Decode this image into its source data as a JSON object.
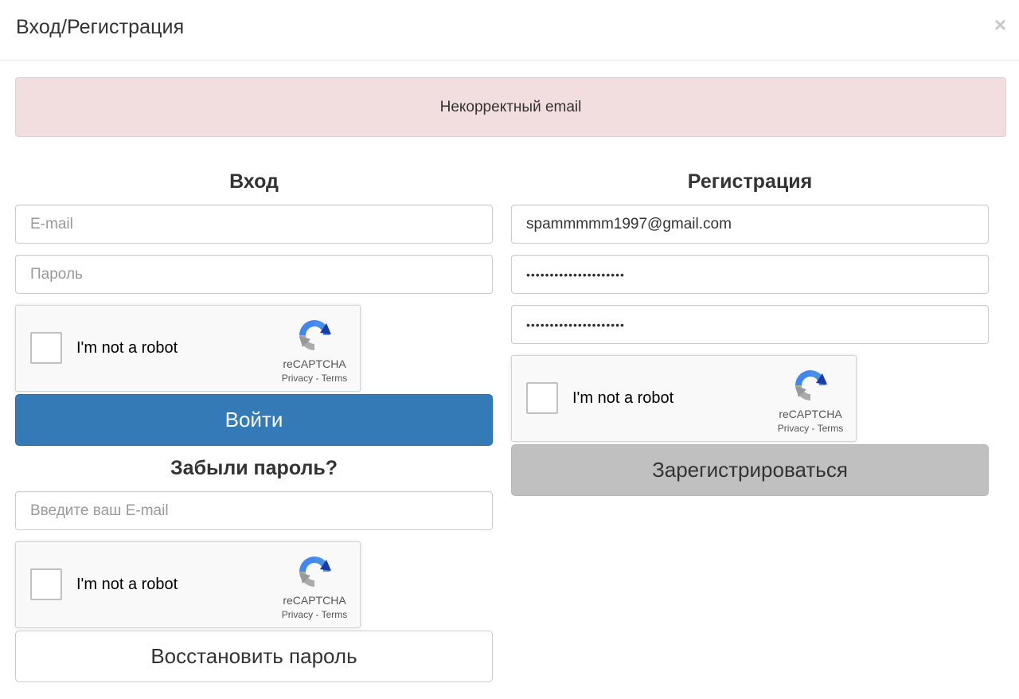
{
  "modal": {
    "title": "Вход/Регистрация",
    "close_glyph": "×"
  },
  "alert": {
    "message": "Некорректный email"
  },
  "login": {
    "title": "Вход",
    "email_placeholder": "E-mail",
    "password_placeholder": "Пароль",
    "submit_label": "Войти"
  },
  "forgot": {
    "title": "Забыли пароль?",
    "email_placeholder": "Введите ваш E-mail",
    "submit_label": "Восстановить пароль"
  },
  "register": {
    "title": "Регистрация",
    "email_value": "spammmmm1997@gmail.com",
    "password_value": "•••••••••••••••••••••",
    "password_confirm_value": "•••••••••••••••••••••",
    "submit_label": "Зарегистрироваться"
  },
  "recaptcha": {
    "label": "I'm not a robot",
    "brand": "reCAPTCHA",
    "privacy": "Privacy",
    "separator": " - ",
    "terms": "Terms",
    "icon": "recaptcha-logo-icon"
  },
  "colors": {
    "primary": "#337ab7",
    "alert_bg": "#f2dede",
    "disabled": "#c0c0c0"
  }
}
